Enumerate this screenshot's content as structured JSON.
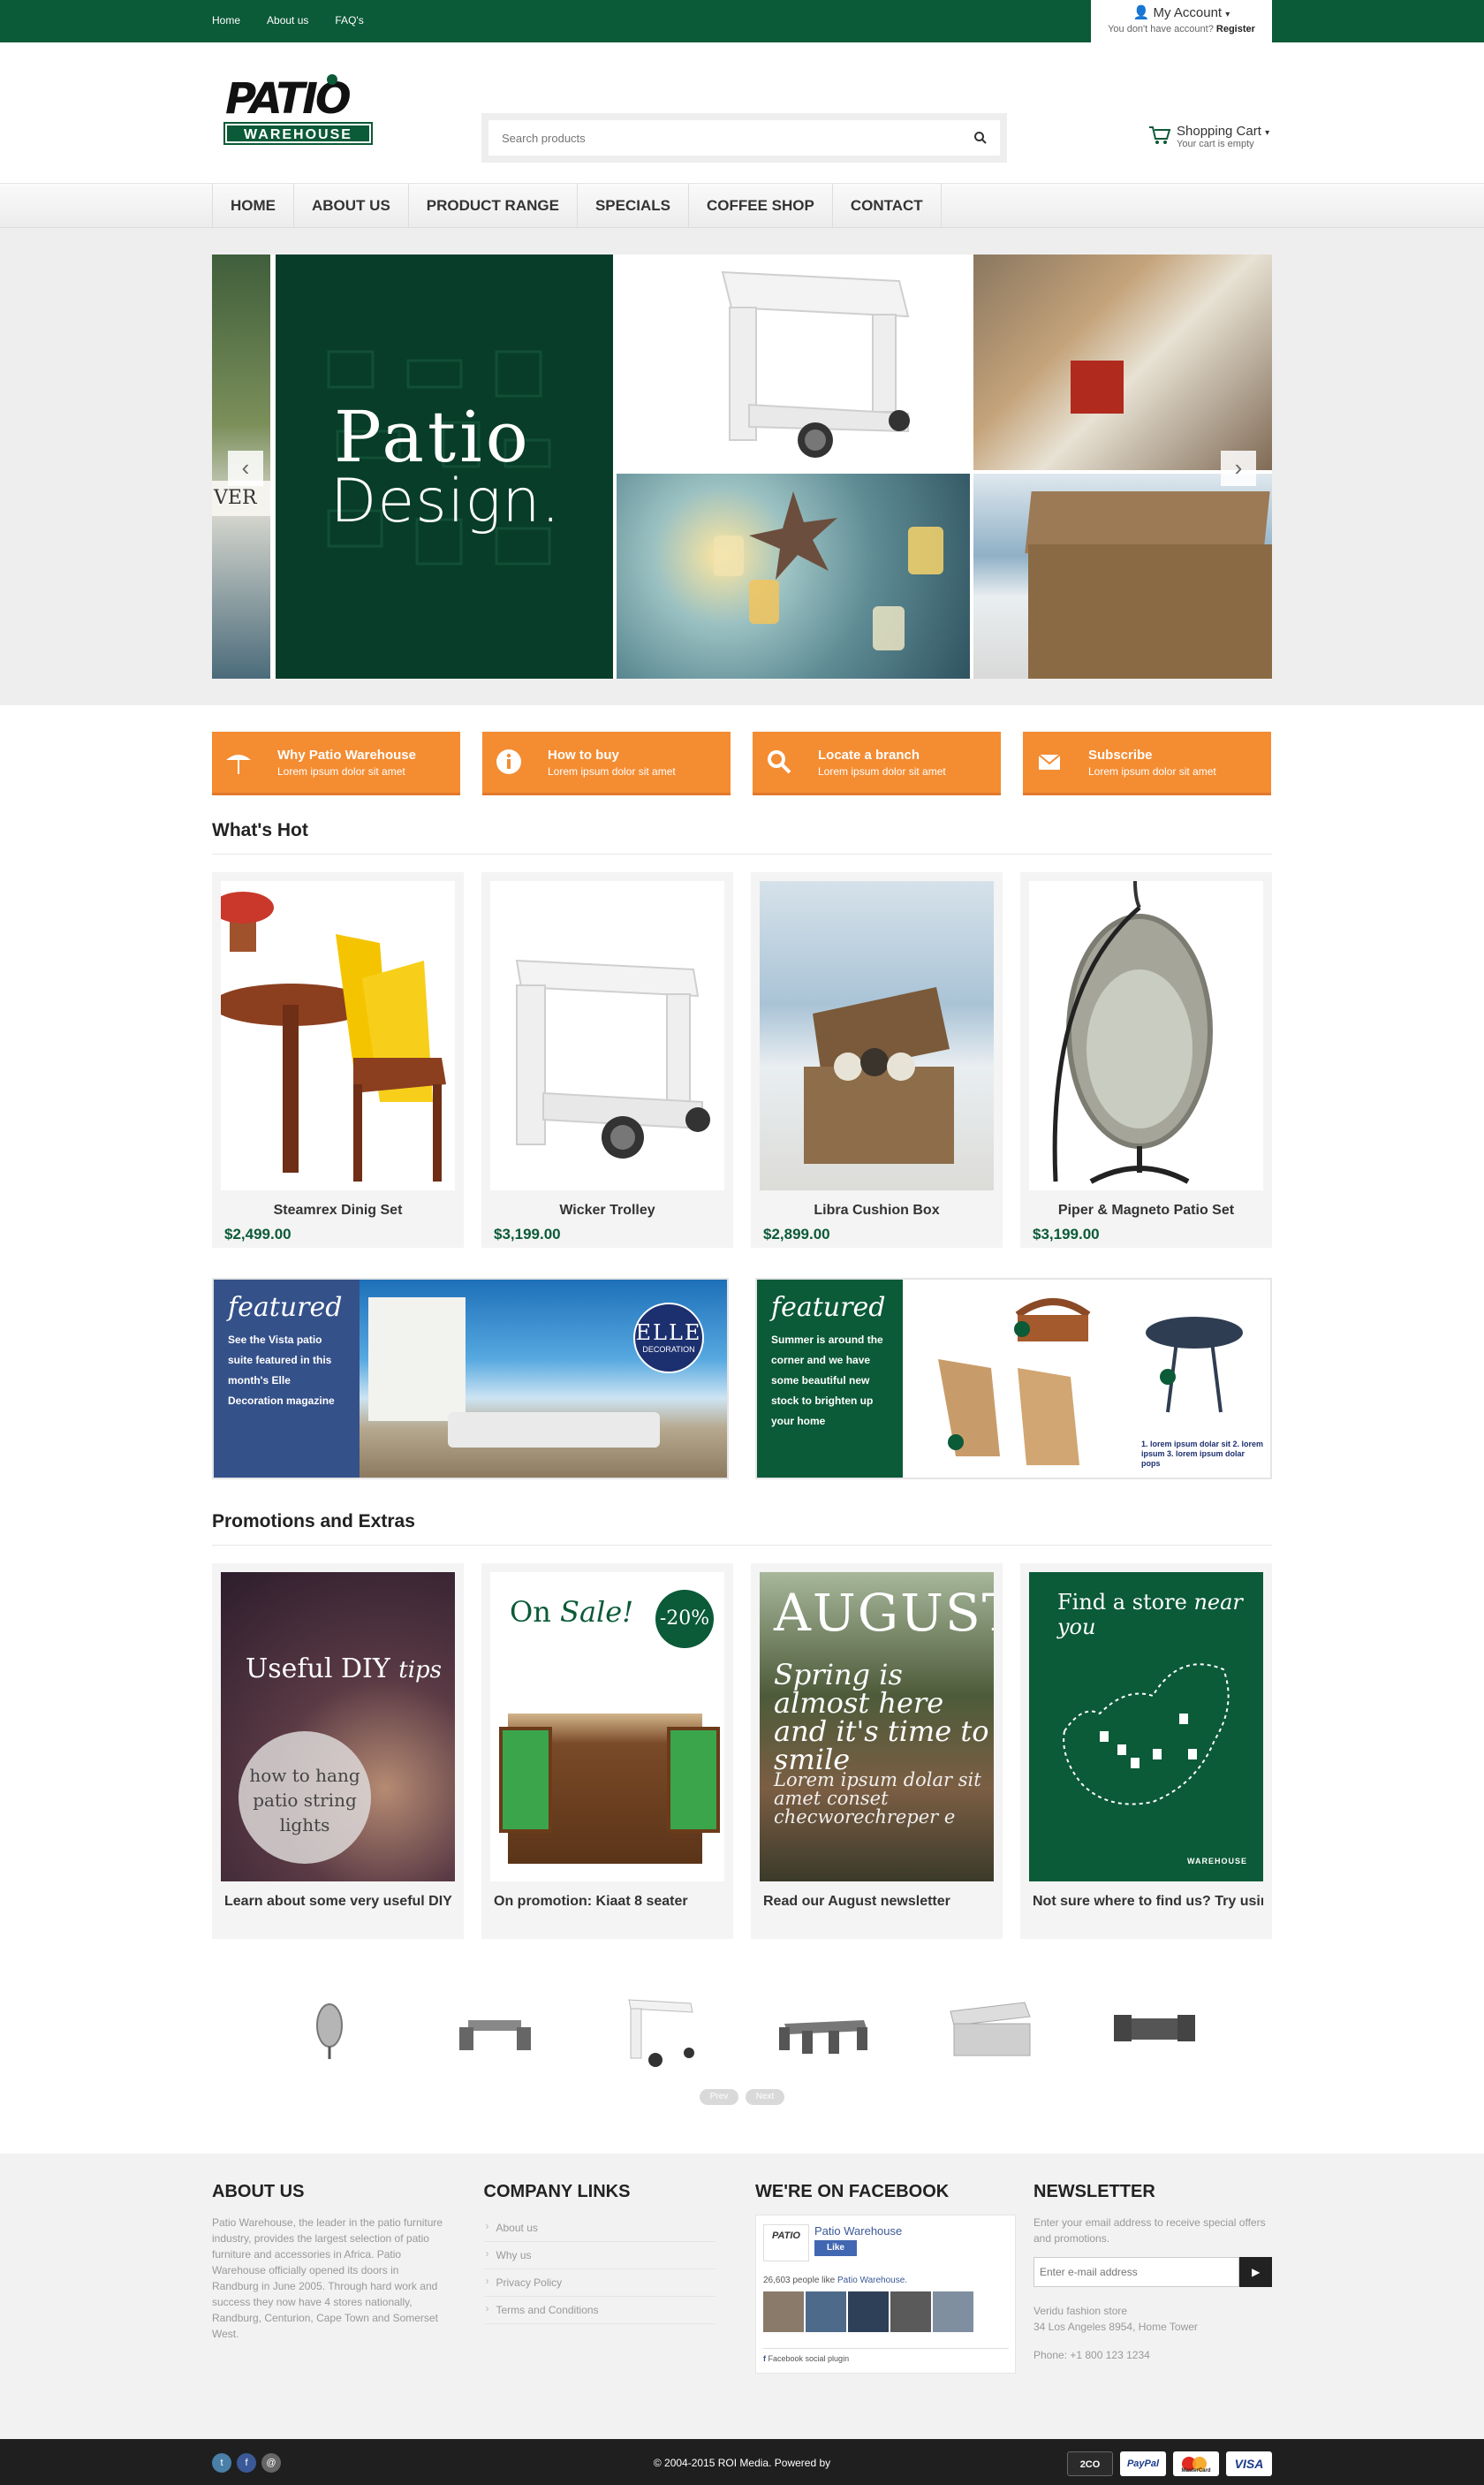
{
  "topbar": {
    "links": [
      "Home",
      "About us",
      "FAQ's"
    ],
    "account_title": "My Account",
    "account_sub": "You don't have account?",
    "account_register": "Register"
  },
  "header": {
    "logo_top": "PATIO",
    "logo_bottom": "WAREHOUSE",
    "search_placeholder": "Search products",
    "cart_title": "Shopping Cart",
    "cart_sub": "Your cart is empty"
  },
  "nav": {
    "items": [
      "HOME",
      "ABOUT US",
      "PRODUCT RANGE",
      "SPECIALS",
      "COFFEE SHOP",
      "CONTACT"
    ]
  },
  "hero": {
    "title_line1": "Patio",
    "title_line2": "Design.",
    "side_text": "VER"
  },
  "features": [
    {
      "title": "Why Patio Warehouse",
      "sub": "Lorem ipsum dolor sit amet",
      "icon": "umbrella-icon"
    },
    {
      "title": "How to buy",
      "sub": "Lorem ipsum dolor sit amet",
      "icon": "info-icon"
    },
    {
      "title": "Locate a branch",
      "sub": "Lorem ipsum dolor sit amet",
      "icon": "search-icon"
    },
    {
      "title": "Subscribe",
      "sub": "Lorem ipsum dolor sit amet",
      "icon": "envelope-icon"
    }
  ],
  "whats_hot": {
    "title": "What's Hot",
    "products": [
      {
        "name": "Steamrex Dinig Set",
        "price": "$2,499.00"
      },
      {
        "name": "Wicker Trolley",
        "price": "$3,199.00"
      },
      {
        "name": "Libra Cushion Box",
        "price": "$2,899.00"
      },
      {
        "name": "Piper & Magneto Patio Set",
        "price": "$3,199.00"
      }
    ]
  },
  "featured": [
    {
      "title": "featured",
      "desc": "See the Vista patio suite featured in this month's Elle Decoration magazine",
      "badge_main": "ELLE",
      "badge_sub": "DECORATION"
    },
    {
      "title": "featured",
      "desc": "Summer is around the corner and we have some beautiful new stock to brighten up your home",
      "captions": "1. lorem ipsum dolar sit  2. lorem ipsum   3. lorem ipsum dolar pops"
    }
  ],
  "promotions": {
    "title": "Promotions and Extras",
    "items": [
      {
        "caption": "Learn about some very useful DIY tips",
        "img_title": "Useful DIY",
        "img_title_italic": "tips",
        "img_circle": "how to hang patio string lights"
      },
      {
        "caption": "On promotion: Kiaat 8 seater",
        "img_title": "On",
        "img_title_italic": "Sale!",
        "img_badge": "-20%"
      },
      {
        "caption": "Read our August newsletter",
        "img_title": "AUGUST",
        "img_sub": "Spring is almost here and it's time to smile",
        "img_lorem": "Lorem ipsum dolar sit amet conset checworechreper e"
      },
      {
        "caption": "Not sure where to find us? Try using",
        "img_title": "Find a store",
        "img_title_italic": "near you",
        "img_logo": "WAREHOUSE"
      }
    ]
  },
  "carousel": {
    "prev": "Prev",
    "next": "Next"
  },
  "footer": {
    "about_title": "ABOUT US",
    "about_text": "Patio Warehouse, the leader in the patio furniture industry, provides the largest selection of patio furniture and accessories in Africa. Patio Warehouse officially opened its doors in Randburg in June 2005. Through hard work and success they now have 4 stores nationally, Randburg, Centurion, Cape Town and Somerset West.",
    "links_title": "COMPANY LINKS",
    "links": [
      "About us",
      "Why us",
      "Privacy Policy",
      "Terms and Conditions"
    ],
    "facebook_title": "WE'RE ON FACEBOOK",
    "fb_page": "Patio Warehouse",
    "fb_like": "Like",
    "fb_count": "26,603 people like",
    "fb_count_page": "Patio Warehouse.",
    "fb_plugin": "Facebook social plugin",
    "newsletter_title": "NEWSLETTER",
    "newsletter_text": "Enter your email address to receive special offers and promotions.",
    "newsletter_placeholder": "Enter e-mail address",
    "address_line1": "Veridu fashion store",
    "address_line2": "34 Los Angeles 8954, Home Tower",
    "phone": "Phone: +1 800 123 1234"
  },
  "bottombar": {
    "copyright": "© 2004-2015 ROI Media.   Powered by",
    "payments": [
      "2CO",
      "PayPal",
      "MasterCard",
      "VISA"
    ]
  },
  "colors": {
    "brand_green": "#0b5a38",
    "accent_orange": "#f48c32"
  }
}
